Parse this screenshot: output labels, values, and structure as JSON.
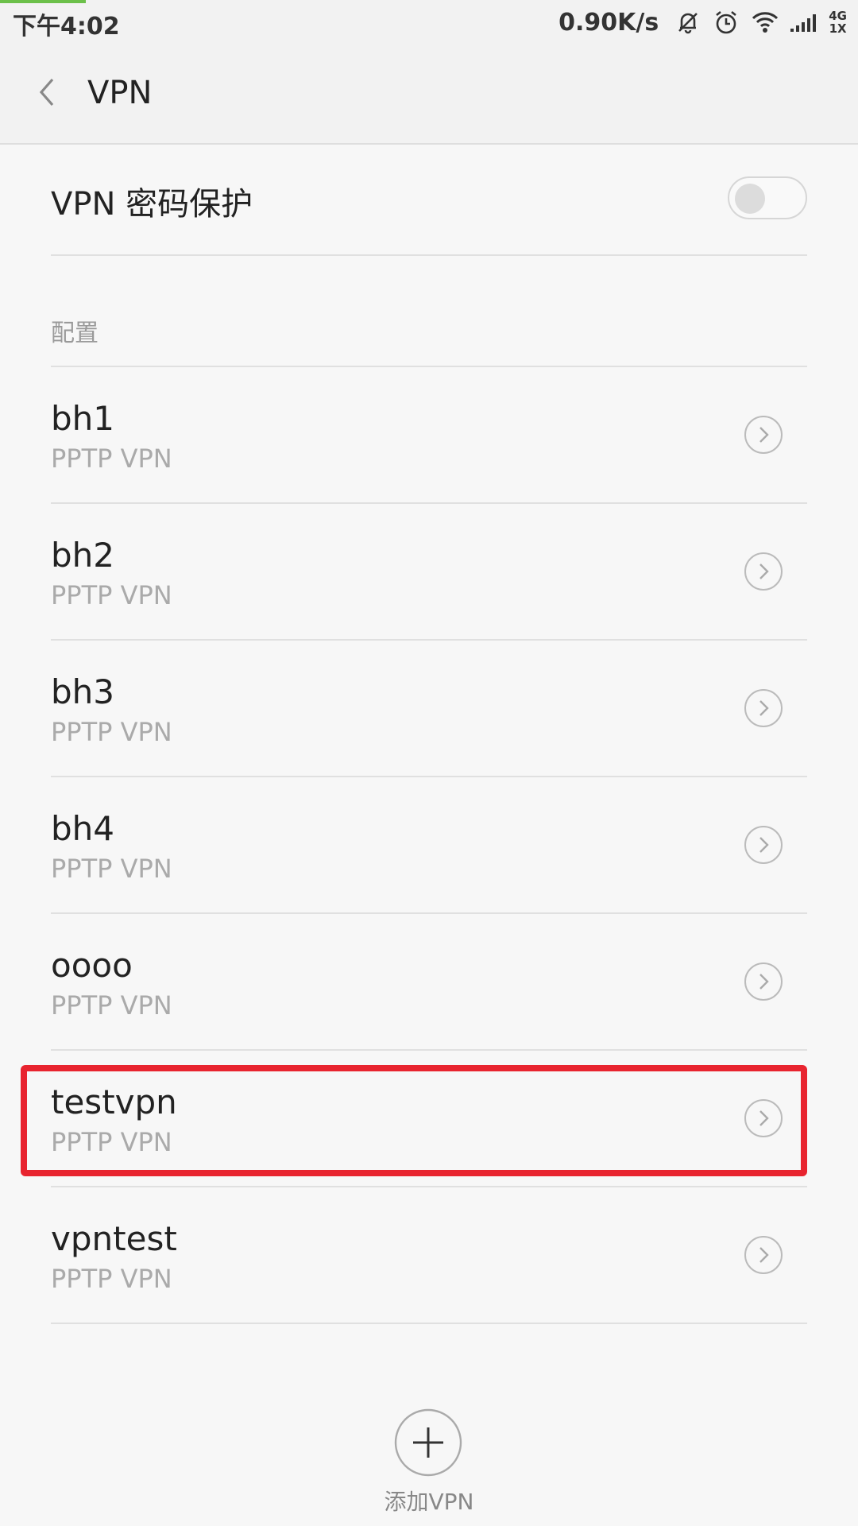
{
  "status_bar": {
    "time": "下午4:02",
    "speed": "0.90K/s",
    "network_top": "4G",
    "network_bottom": "1X",
    "icons": [
      "mute-bell-icon",
      "alarm-clock-icon",
      "wifi-icon",
      "signal-icon"
    ]
  },
  "app_bar": {
    "title": "VPN",
    "back_icon": "chevron-left-icon"
  },
  "password_protection": {
    "label": "VPN 密码保护",
    "enabled": false
  },
  "config_section": {
    "header": "配置"
  },
  "vpn_list": [
    {
      "name": "bh1",
      "type": "PPTP VPN"
    },
    {
      "name": "bh2",
      "type": "PPTP VPN"
    },
    {
      "name": "bh3",
      "type": "PPTP VPN"
    },
    {
      "name": "bh4",
      "type": "PPTP VPN"
    },
    {
      "name": "oooo",
      "type": "PPTP VPN"
    },
    {
      "name": "testvpn",
      "type": "PPTP VPN",
      "highlighted": true
    },
    {
      "name": "vpntest",
      "type": "PPTP VPN"
    }
  ],
  "add_vpn": {
    "label": "添加VPN",
    "icon": "plus-icon"
  },
  "colors": {
    "highlight": "#e8242f",
    "progress": "#6cc04a",
    "background": "#f7f7f7"
  }
}
